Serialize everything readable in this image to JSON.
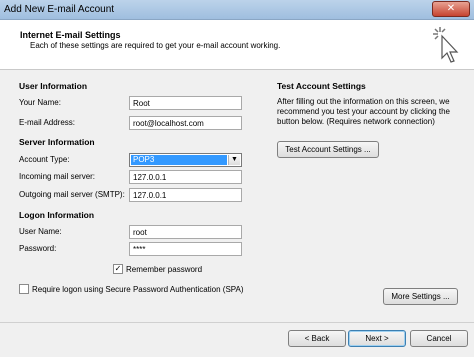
{
  "window": {
    "title": "Add New E-mail Account",
    "close_glyph": "✕"
  },
  "header": {
    "title": "Internet E-mail Settings",
    "subtitle": "Each of these settings are required to get your e-mail account working."
  },
  "user_info": {
    "heading": "User Information",
    "name_label": "Your Name:",
    "name_value": "Root",
    "email_label": "E-mail Address:",
    "email_value": "root@localhost.com"
  },
  "server_info": {
    "heading": "Server Information",
    "account_type_label": "Account Type:",
    "account_type_value": "POP3",
    "incoming_label": "Incoming mail server:",
    "incoming_value": "127.0.0.1",
    "outgoing_label": "Outgoing mail server (SMTP):",
    "outgoing_value": "127.0.0.1"
  },
  "logon_info": {
    "heading": "Logon Information",
    "username_label": "User Name:",
    "username_value": "root",
    "password_label": "Password:",
    "password_value": "****",
    "remember_label": "Remember password",
    "remember_checked": true,
    "spa_label": "Require logon using Secure Password Authentication (SPA)",
    "spa_checked": false
  },
  "test_settings": {
    "heading": "Test Account Settings",
    "description": "After filling out the information on this screen, we recommend you test your account by clicking the button below. (Requires network connection)",
    "test_button": "Test Account Settings ..."
  },
  "buttons": {
    "more_settings": "More Settings ...",
    "back": "< Back",
    "next": "Next >",
    "cancel": "Cancel"
  },
  "icons": {
    "checkmark": "✓",
    "dropdown": "▼"
  }
}
